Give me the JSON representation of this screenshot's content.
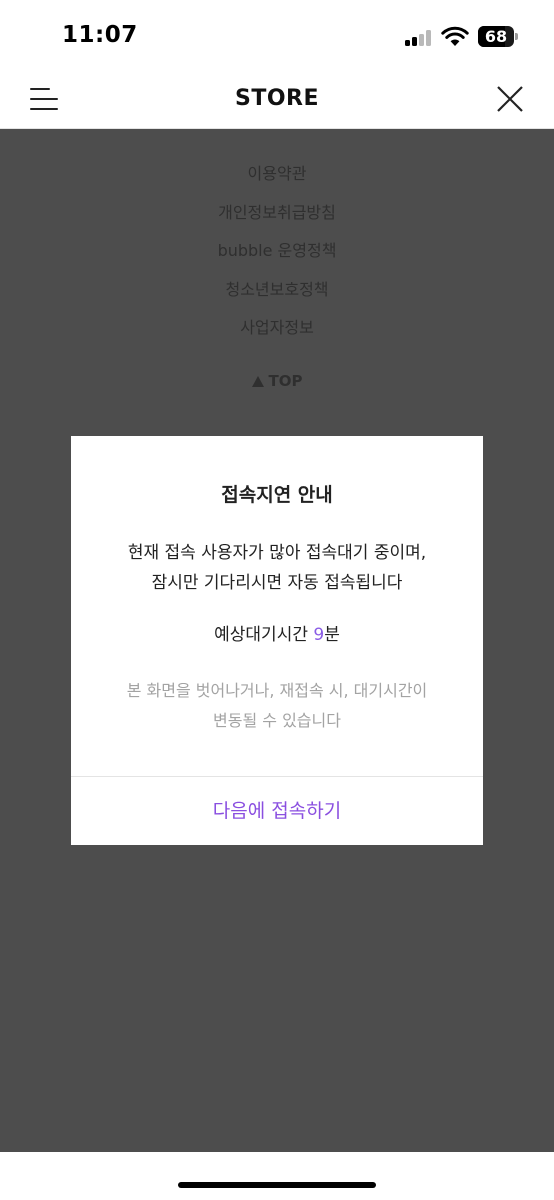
{
  "status_bar": {
    "time": "11:07",
    "battery_percent": "68",
    "icons": [
      "cellular-signal-icon",
      "wifi-icon",
      "battery-icon"
    ]
  },
  "header": {
    "title": "STORE",
    "menu_icon": "hamburger-menu-icon",
    "close_icon": "close-icon"
  },
  "footer": {
    "links": [
      "이용약관",
      "개인정보취급방침",
      "bubble 운영정책",
      "청소년보호정책",
      "사업자정보"
    ],
    "top_label": "TOP",
    "top_icon": "triangle-up-icon"
  },
  "modal": {
    "title": "접속지연 안내",
    "message_line1": "현재 접속 사용자가 많아 접속대기 중이며,",
    "message_line2": "잠시만 기다리시면 자동 접속됩니다",
    "wait_label": "예상대기시간 ",
    "wait_value": "9",
    "wait_unit": "분",
    "note_line1": "본 화면을 벗어나거나, 재접속 시, 대기시간이",
    "note_line2": "변동될 수 있습니다",
    "action_label": "다음에 접속하기"
  },
  "colors": {
    "overlay": "#4d4d4d",
    "accent": "#8a4fe0",
    "note_text": "#a3a3a3"
  }
}
